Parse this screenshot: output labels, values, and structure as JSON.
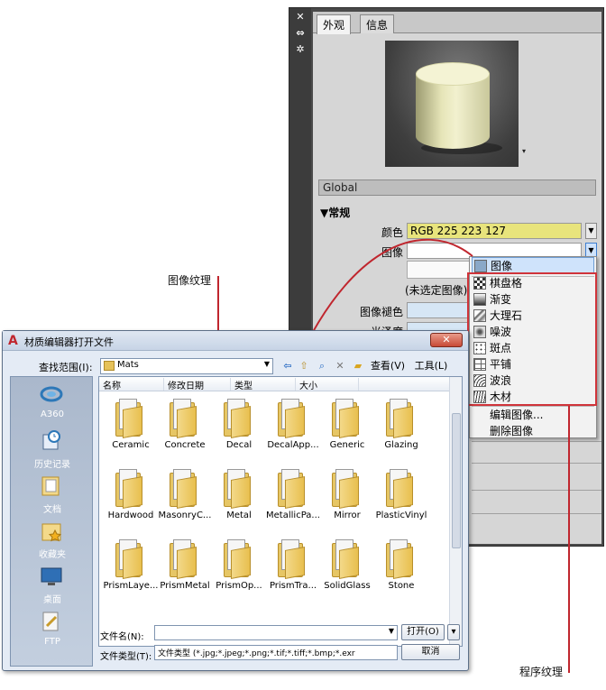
{
  "palette": {
    "tabs": [
      "外观",
      "信息"
    ],
    "strip_buttons": [
      "✕",
      "⇔",
      "✲"
    ],
    "preview_menu": "▾",
    "global": "Global",
    "section_general": "▼常规",
    "color_label": "颜色",
    "color_value": "RGB 225 223 127",
    "image_label": "图像",
    "unselected": "(未选定图像)",
    "image_fade_label": "图像褪色",
    "glossiness_label": "光泽度"
  },
  "dropdown": {
    "items": [
      "图像",
      "棋盘格",
      "渐变",
      "大理石",
      "噪波",
      "斑点",
      "平铺",
      "波浪",
      "木材"
    ],
    "actions": [
      "编辑图像...",
      "删除图像"
    ]
  },
  "annotations": {
    "image_texture": "图像纹理",
    "procedural_texture": "程序纹理"
  },
  "dialog": {
    "title": "材质编辑器打开文件",
    "close_glyph": "✕",
    "look_in_label": "查找范围(I):",
    "look_in_value": "Mats",
    "toolbar": {
      "view_label": "查看(V)",
      "tools_label": "工具(L)"
    },
    "places": [
      "A360",
      "历史记录",
      "文档",
      "收藏夹",
      "桌面",
      "FTP"
    ],
    "columns": [
      "名称",
      "修改日期",
      "类型",
      "大小"
    ],
    "files": [
      "Ceramic",
      "Concrete",
      "Decal",
      "DecalApp...",
      "Generic",
      "Glazing",
      "Hardwood",
      "MasonryC...",
      "Metal",
      "MetallicPa...",
      "Mirror",
      "PlasticVinyl",
      "PrismLaye...",
      "PrismMetal",
      "PrismOp...",
      "PrismTra...",
      "SolidGlass",
      "Stone"
    ],
    "filename_label": "文件名(N):",
    "filetype_label": "文件类型(T):",
    "filetype_value": "文件类型 (*.jpg;*.jpeg;*.png;*.tif;*.tiff;*.bmp;*.exr",
    "open_button": "打开(O)",
    "cancel_button": "取消"
  }
}
